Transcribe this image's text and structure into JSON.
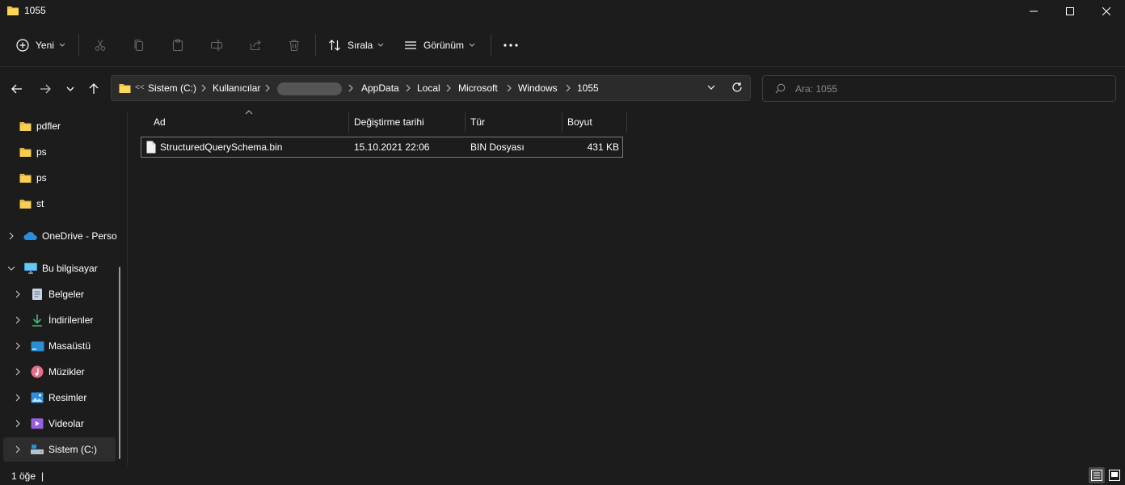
{
  "window": {
    "title": "1055",
    "folder_icon": "folder-icon",
    "controls": [
      "minimize-icon",
      "maximize-icon",
      "close-icon"
    ]
  },
  "toolbar": {
    "new_label": "Yeni",
    "sort_label": "Sırala",
    "view_label": "Görünüm",
    "icons": [
      "cut-icon",
      "copy-icon",
      "paste-icon",
      "rename-icon",
      "share-icon",
      "delete-icon",
      "more-icon"
    ]
  },
  "address": {
    "overflow": "<<",
    "crumbs": [
      "Sistem (C:)",
      "Kullanıcılar",
      "",
      "AppData",
      "Local",
      "Microsoft",
      "Windows",
      "1055"
    ]
  },
  "search": {
    "placeholder": "Ara: 1055"
  },
  "sidebar": {
    "items": [
      {
        "label": "pdfler",
        "icon": "folder-icon"
      },
      {
        "label": "ps",
        "icon": "folder-icon"
      },
      {
        "label": "ps",
        "icon": "folder-icon"
      },
      {
        "label": "st",
        "icon": "folder-icon"
      },
      {
        "label": "OneDrive - Perso",
        "icon": "onedrive-icon"
      },
      {
        "label": "Bu bilgisayar",
        "icon": "pc-icon"
      },
      {
        "label": "Belgeler",
        "icon": "documents-icon"
      },
      {
        "label": "İndirilenler",
        "icon": "downloads-icon"
      },
      {
        "label": "Masaüstü",
        "icon": "desktop-icon"
      },
      {
        "label": "Müzikler",
        "icon": "music-icon"
      },
      {
        "label": "Resimler",
        "icon": "pictures-icon"
      },
      {
        "label": "Videolar",
        "icon": "videos-icon"
      },
      {
        "label": "Sistem (C:)",
        "icon": "drive-icon"
      }
    ]
  },
  "list": {
    "columns": [
      "Ad",
      "Değiştirme tarihi",
      "Tür",
      "Boyut"
    ],
    "rows": [
      {
        "name": "StructuredQuerySchema.bin",
        "modified": "15.10.2021 22:06",
        "type": "BIN Dosyası",
        "size": "431 KB"
      }
    ]
  },
  "status": {
    "count": "1 öğe",
    "separator": "|"
  },
  "colors": {
    "background": "#1c1c1c",
    "address_bg": "#2b2b2b",
    "folder_yellow": "#f3c73c",
    "selection": "#2d2d2d"
  }
}
